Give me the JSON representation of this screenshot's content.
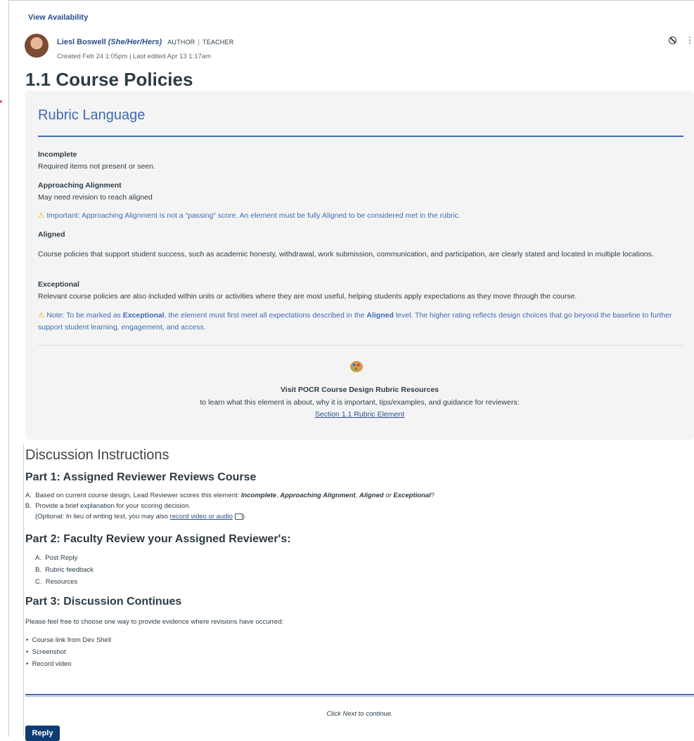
{
  "header": {
    "view_availability": "View Availability",
    "author_name": "Liesl Boswell",
    "author_pronouns": "(She/Her/Hers)",
    "role_author": "AUTHOR",
    "role_separator": "|",
    "role_teacher": "TEACHER",
    "meta": "Created Feb 24 1:05pm | Last edited Apr 13 1:17am",
    "icons": [
      "ban-icon",
      "kebab-menu-icon"
    ]
  },
  "page_title": "1.1 Course Policies",
  "rubric": {
    "heading": "Rubric Language",
    "incomplete_title": "Incomplete",
    "incomplete_text": "Required items not present or seen.",
    "approaching_title": "Approaching Alignment",
    "approaching_text": "May need revision to reach aligned",
    "approaching_note": "Important: Approaching Alignment is not a “passing” score. An element must be fully Aligned to be considered met in the rubric.",
    "aligned_title": "Aligned",
    "aligned_text": "Course policies that support student success, such as academic honesty, withdrawal, work submission, communication, and participation, are clearly stated and located in multiple locations.",
    "exceptional_title": "Exceptional",
    "exceptional_text": "Relevant course policies are also included within units or activities where they are most useful, helping students apply expectations as they move through the course.",
    "exceptional_note_a": "Note: To be marked as",
    "exceptional_note_b": "Exceptional",
    "exceptional_note_c": ", the element must first meet all expectations described in the",
    "exceptional_note_d": "Aligned",
    "exceptional_note_e": "level. The higher rating reflects design choices that go beyond the baseline to further support student learning, engagement, and access.",
    "warning_glyph": "⚠",
    "resources_title": "Visit POCR Course Design Rubric Resources",
    "resources_text": "to learn what this element is about, why it is important, tips/examples, and guidance for reviewers:",
    "resources_link": "Section 1.1 Rubric Element"
  },
  "discussion": {
    "heading": "Discussion Instructions",
    "part1_title": "Part 1: Assigned Reviewer Reviews Course",
    "part1_a_prefix": "A.",
    "part1_a_text": "Based on current course design, Lead Reviewer scores this element:",
    "part1_a_incomplete": "Incomplete",
    "part1_a_approaching": "Approaching Alignment",
    "part1_a_aligned": "Aligned",
    "part1_a_or": "or",
    "part1_a_exceptional": "Exceptional",
    "part1_b_prefix": "B.",
    "part1_b_text": "Provide a brief explanation for your scoring decision.",
    "part1_b_optional_a": "(Optional: In lieu of writing text, you may also",
    "part1_b_link": "record video or audio",
    "part1_b_optional_b": ")",
    "part2_title": "Part 2: Faculty Review your Assigned Reviewer's:",
    "part2_items": [
      "Post Reply",
      "Rubric feedback",
      "Resources"
    ],
    "part2_prefixes": [
      "A.",
      "B.",
      "C."
    ],
    "part3_title": "Part 3: Discussion Continues",
    "part3_intro": "Please feel free to choose one way to provide evidence where revisions have occurred:",
    "part3_items": [
      "Course link from Dev Shell",
      "Screenshot",
      "Record video"
    ],
    "bullet": "•",
    "next_note": "Click Next to continue.",
    "reply_button": "Reply"
  },
  "colors": {
    "link_blue": "#2b4f8c",
    "rubric_blue": "#3e6bb1",
    "warning_yellow": "#f0a500",
    "button_navy": "#0f3b73",
    "panel_gray": "#f4f4f4"
  }
}
